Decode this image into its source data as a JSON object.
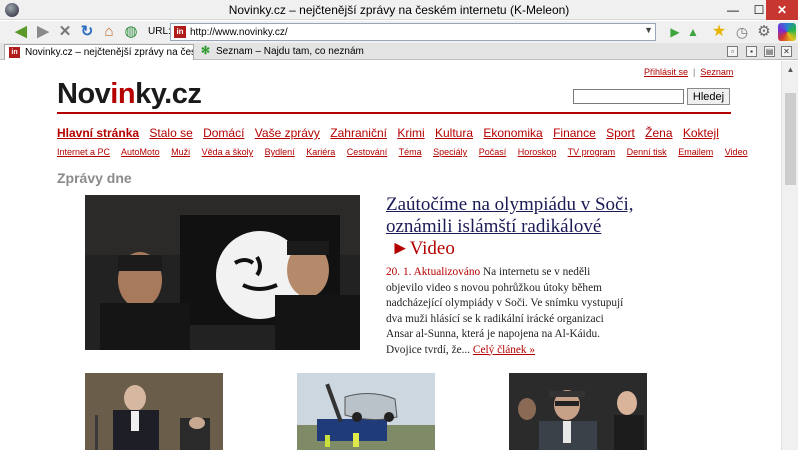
{
  "window": {
    "title": "Novinky.cz  – nejčtenější zprávy na českém internetu (K-Meleon)"
  },
  "toolbar": {
    "url_label": "URL:",
    "url": "http://www.novinky.cz/",
    "icons": [
      "back-arrow-icon",
      "forward-arrow-icon",
      "stop-icon",
      "reload-icon",
      "home-icon",
      "globe-icon",
      "go-icon",
      "up-icon",
      "bookmark-star-icon",
      "history-icon",
      "settings-gear-icon"
    ]
  },
  "tabs": [
    {
      "label": "Novinky.cz  – nejčtenější zprávy na českém in...",
      "favicon": "in",
      "active": true
    },
    {
      "label": "Seznam – Najdu tam, co neznám",
      "favicon": "seznam-flower",
      "active": false
    }
  ],
  "site": {
    "top_links": {
      "login": "Přihlásit se",
      "seznam": "Seznam"
    },
    "logo": {
      "part1": "Nov",
      "part2": "in",
      "part3": "ky.cz"
    },
    "search": {
      "value": "",
      "button": "Hledej"
    },
    "nav_main": [
      "Hlavní stránka",
      "Stalo se",
      "Domácí",
      "Vaše zprávy",
      "Zahraniční",
      "Krimi",
      "Kultura",
      "Ekonomika",
      "Finance",
      "Sport",
      "Žena",
      "Koktejl"
    ],
    "nav_sub": [
      "Internet a PC",
      "AutoMoto",
      "Muži",
      "Věda a školy",
      "Bydlení",
      "Kariéra",
      "Cestování",
      "Téma",
      "Speciály",
      "Počasí",
      "Horoskop",
      "TV program",
      "Denní tisk",
      "Emailem",
      "Video"
    ],
    "section_title": "Zprávy dne",
    "lead": {
      "headline": "Zaútočíme na olympiádu v Soči, oznámili islámští radikálové",
      "video_label": "Video",
      "timestamp": "20. 1. Aktualizováno",
      "body": "Na internetu se v neděli objevilo video s novou pohrůžkou útoky během nadcházející olympiády v Soči. Ve snímku vystupují dva muži hlásící se k radikální irácké organizaci Ansar al-Sunna, která je napojena na Al-Káidu. Dvojice tvrdí, že...",
      "more_link": "Celý článek »"
    }
  },
  "colors": {
    "accent_red": "#b50000",
    "headline_navy": "#1a1a55",
    "section_grey": "#8a8a8a"
  }
}
